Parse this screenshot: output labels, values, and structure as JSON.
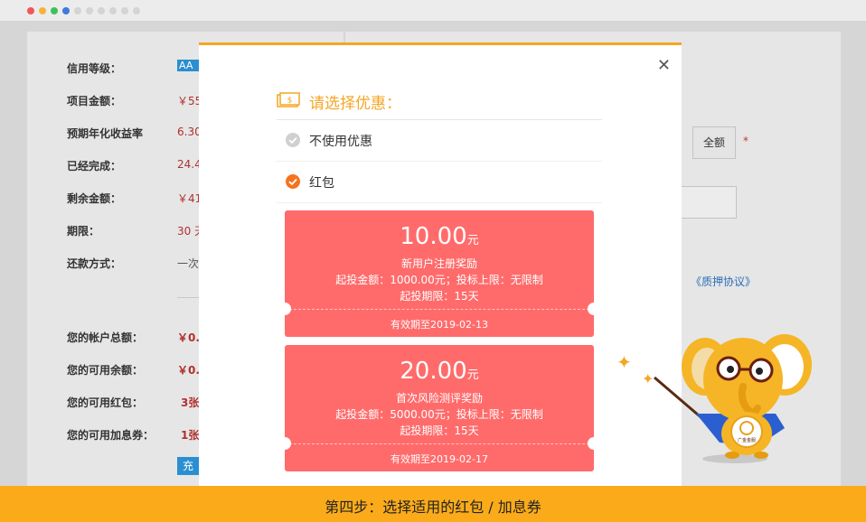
{
  "background": {
    "rows": [
      {
        "label": "信用等级：",
        "value": "AA"
      },
      {
        "label": "项目金额：",
        "value": "￥55"
      },
      {
        "label": "预期年化收益率",
        "value": "6.30"
      },
      {
        "label": "已经完成：",
        "value": "24.4"
      },
      {
        "label": "剩余金额：",
        "value": "￥41"
      },
      {
        "label": "期限：",
        "value": "30 天"
      },
      {
        "label": "还款方式：",
        "value": "一次"
      }
    ],
    "account_rows": [
      {
        "label": "您的帐户总额：",
        "value": "￥0."
      },
      {
        "label": "您的可用余额：",
        "value": "￥0."
      },
      {
        "label": "您的可用红包：",
        "value": "3张"
      },
      {
        "label": "您的可用加息券：",
        "value": "1张"
      }
    ],
    "recharge_label": "充",
    "all_button": "全额",
    "required_mark": "*",
    "agreement_link": "《质押协议》"
  },
  "modal": {
    "title": "请选择优惠：",
    "options": [
      {
        "label": "不使用优惠",
        "selected": false
      },
      {
        "label": "红包",
        "selected": true
      }
    ],
    "coupons": [
      {
        "amount": "10.00",
        "unit": "元",
        "name": "新用户注册奖励",
        "condition": "起投金额：1000.00元；投标上限：无限制",
        "period": "起投期限：15天",
        "expiry": "有效期至2019-02-13"
      },
      {
        "amount": "20.00",
        "unit": "元",
        "name": "首次风险测评奖励",
        "condition": "起投金额：5000.00元；投标上限：无限制",
        "period": "起投期限：15天",
        "expiry": "有效期至2019-02-17"
      }
    ]
  },
  "mascot": {
    "badge_text": "广金金服"
  },
  "footer": {
    "step_text": "第四步：选择适用的红包 / 加息券"
  },
  "colors": {
    "accent": "#f5a623",
    "coupon": "#ff6b6b",
    "footer": "#fbab1a",
    "selected": "#f5731f"
  }
}
